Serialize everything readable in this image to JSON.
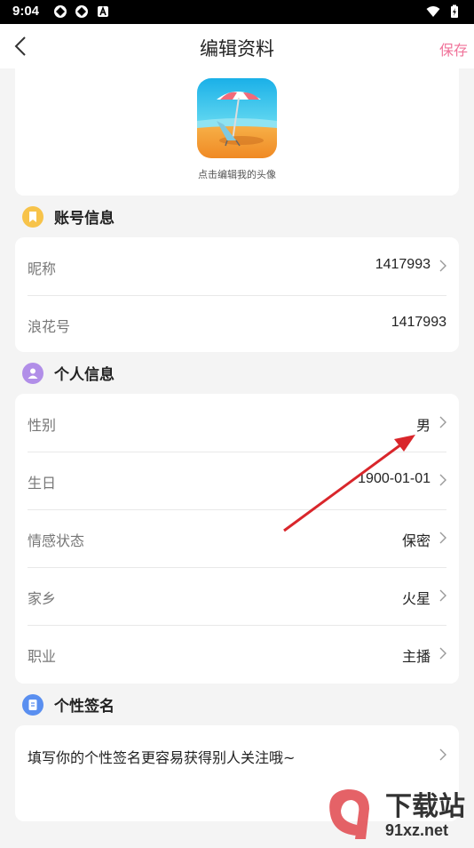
{
  "status_bar": {
    "time": "9:04"
  },
  "header": {
    "title": "编辑资料",
    "save_label": "保存"
  },
  "avatar": {
    "hint": "点击编辑我的头像"
  },
  "account_section": {
    "title": "账号信息",
    "rows": [
      {
        "label": "昵称",
        "value": "1417993"
      },
      {
        "label": "浪花号",
        "value": "1417993"
      }
    ]
  },
  "personal_section": {
    "title": "个人信息",
    "rows": [
      {
        "label": "性别",
        "value": "男"
      },
      {
        "label": "生日",
        "value": "1900-01-01"
      },
      {
        "label": "情感状态",
        "value": "保密"
      },
      {
        "label": "家乡",
        "value": "火星"
      },
      {
        "label": "职业",
        "value": "主播"
      }
    ]
  },
  "signature_section": {
    "title": "个性签名",
    "placeholder": "填写你的个性签名更容易获得别人关注哦~"
  },
  "watermark": {
    "text": "下载站",
    "url": "91xz.net"
  },
  "colors": {
    "accent": "#f0739a",
    "account_icon": "#f7c34a",
    "personal_icon": "#b18ee8",
    "signature_icon": "#5a8ff0",
    "annotation_arrow": "#d9262b"
  }
}
